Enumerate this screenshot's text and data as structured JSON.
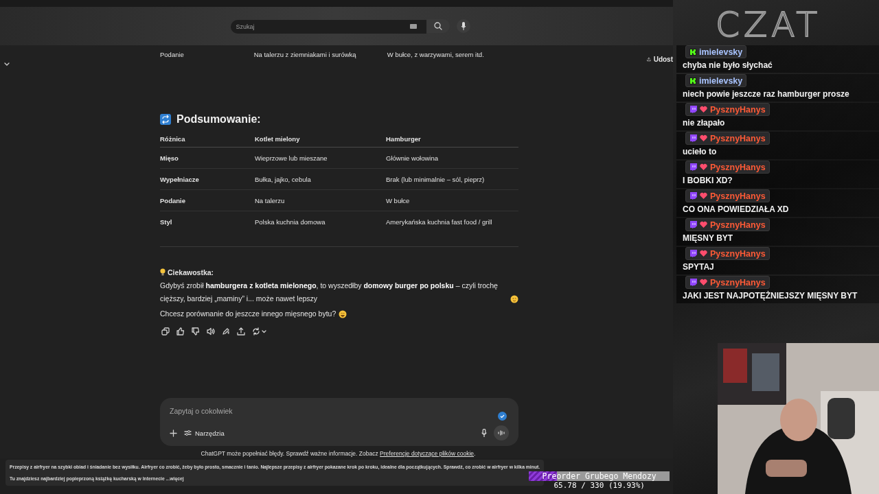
{
  "browser": {
    "search_placeholder": "Szukaj",
    "share_label": "Udost"
  },
  "previous_row": {
    "cells": [
      "Podanie",
      "Na talerzu z ziemniakami i surówką",
      "W bułce, z warzywami, serem itd."
    ]
  },
  "summary": {
    "title": "Podsumowanie:",
    "columns": [
      "Różnica",
      "Kotlet mielony",
      "Hamburger"
    ],
    "rows": [
      [
        "Mięso",
        "Wieprzowe lub mieszane",
        "Głównie wołowina"
      ],
      [
        "Wypełniacze",
        "Bułka, jajko, cebula",
        "Brak (lub minimalnie – sól, pieprz)"
      ],
      [
        "Podanie",
        "Na talerzu",
        "W bułce"
      ],
      [
        "Styl",
        "Polska kuchnia domowa",
        "Amerykańska kuchnia fast food / grill"
      ]
    ]
  },
  "fun_fact": {
    "title": "Ciekawostka:",
    "paragraphs": [
      "Gdybyś zrobił **hamburgera z kotleta mielonego**, to wyszedłby **domowy burger po polsku** – czyli trochę cięższy, bardziej „maminy” i... może nawet lepszy",
      "Chcesz porównanie do jeszcze innego mięsnego bytu?"
    ]
  },
  "composer": {
    "placeholder": "Zapytaj o cokolwiek",
    "tools_label": "Narzędzia"
  },
  "disclaimer": {
    "text": "ChatGPT może popełniać błędy. Sprawdź ważne informacje. Zobacz",
    "link": "Preferencje dotyczące plików cookie",
    "end": "."
  },
  "video_description": {
    "lines": [
      "Przepisy z airfryer na szybki obiad i śniadanie bez wysiłku. Airfryer co zrobić, żeby było prosto, smacznie i tanio. Najlepsze przepisy z airfryer pokazane krok po kroku, idealne dla początkujących. Sprawdź, co zrobić w airfryer w kilka minut.",
      "Tu znajdziesz najbardziej popieprzoną książkę kucharską w Internecie"
    ],
    "more": "...więcej"
  },
  "chat": {
    "title": "CZAT",
    "messages": [
      {
        "user": "imielevsky",
        "kind": "kick",
        "color": "#a9c4ff",
        "text": "chyba nie było słychać"
      },
      {
        "user": "imielevsky",
        "kind": "kick",
        "color": "#a9c4ff",
        "text": "niech powie jeszcze raz hamburger prosze"
      },
      {
        "user": "PysznyHanys",
        "kind": "twitch",
        "color": "#ff5a36",
        "text": "nie złapało"
      },
      {
        "user": "PysznyHanys",
        "kind": "twitch",
        "color": "#ff5a36",
        "text": "ucieło to"
      },
      {
        "user": "PysznyHanys",
        "kind": "twitch",
        "color": "#ff5a36",
        "text": "I BOBKI XD?"
      },
      {
        "user": "PysznyHanys",
        "kind": "twitch",
        "color": "#ff5a36",
        "text": "CO ONA POWIEDZIAŁA XD"
      },
      {
        "user": "PysznyHanys",
        "kind": "twitch",
        "color": "#ff5a36",
        "text": "MIĘSNY BYT"
      },
      {
        "user": "PysznyHanys",
        "kind": "twitch",
        "color": "#ff5a36",
        "text": "SPYTAJ"
      },
      {
        "user": "PysznyHanys",
        "kind": "twitch",
        "color": "#ff5a36",
        "text": "JAKI JEST NAJPOTĘŻNIEJSZY MIĘSNY BYT"
      }
    ]
  },
  "goal": {
    "title": "Preorder Grubego Mendozy",
    "level": 0.1993,
    "reading": "65.78 / 330 (19.93%)"
  }
}
